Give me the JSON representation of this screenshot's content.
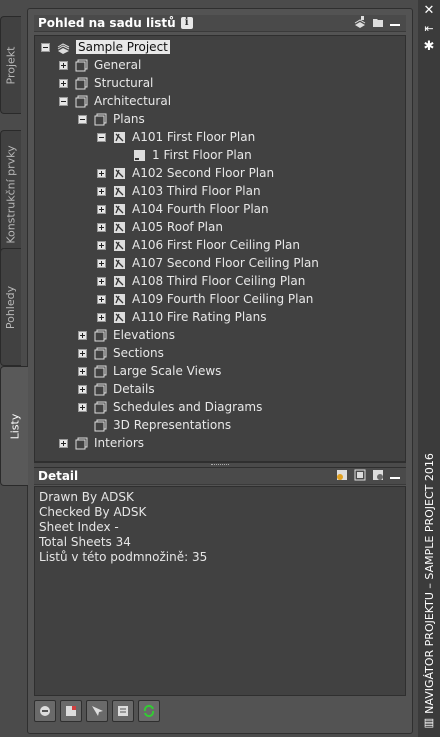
{
  "side_tabs": [
    "Projekt",
    "Konstrukční prvky",
    "Pohledy",
    "Listy"
  ],
  "tree_panel": {
    "title": "Pohled na sadu listů",
    "info": "i"
  },
  "tree": [
    {
      "label": "Sample Project"
    },
    {
      "label": "General"
    },
    {
      "label": "Structural"
    },
    {
      "label": "Architectural"
    },
    {
      "label": "Plans"
    },
    {
      "label": "A101 First Floor Plan"
    },
    {
      "label": "1 First Floor Plan"
    },
    {
      "label": "A102 Second Floor Plan"
    },
    {
      "label": "A103 Third Floor Plan"
    },
    {
      "label": "A104 Fourth Floor Plan"
    },
    {
      "label": "A105 Roof Plan"
    },
    {
      "label": "A106 First Floor Ceiling Plan"
    },
    {
      "label": "A107 Second Floor Ceiling Plan"
    },
    {
      "label": "A108 Third Floor Ceiling Plan"
    },
    {
      "label": "A109 Fourth Floor Ceiling Plan"
    },
    {
      "label": "A110 Fire Rating Plans"
    },
    {
      "label": "Elevations"
    },
    {
      "label": "Sections"
    },
    {
      "label": "Large Scale Views"
    },
    {
      "label": "Details"
    },
    {
      "label": "Schedules and Diagrams"
    },
    {
      "label": "3D Representations"
    },
    {
      "label": "Interiors"
    }
  ],
  "detail_panel": {
    "title": "Detail",
    "lines": [
      "Drawn By ADSK",
      "Checked By ADSK",
      "Sheet Index -",
      "Total Sheets 34",
      "Listů v této podmnožině: 35"
    ]
  },
  "window": {
    "title": "NAVIGÁTOR PROJEKTU – SAMPLE PROJECT 2016"
  }
}
